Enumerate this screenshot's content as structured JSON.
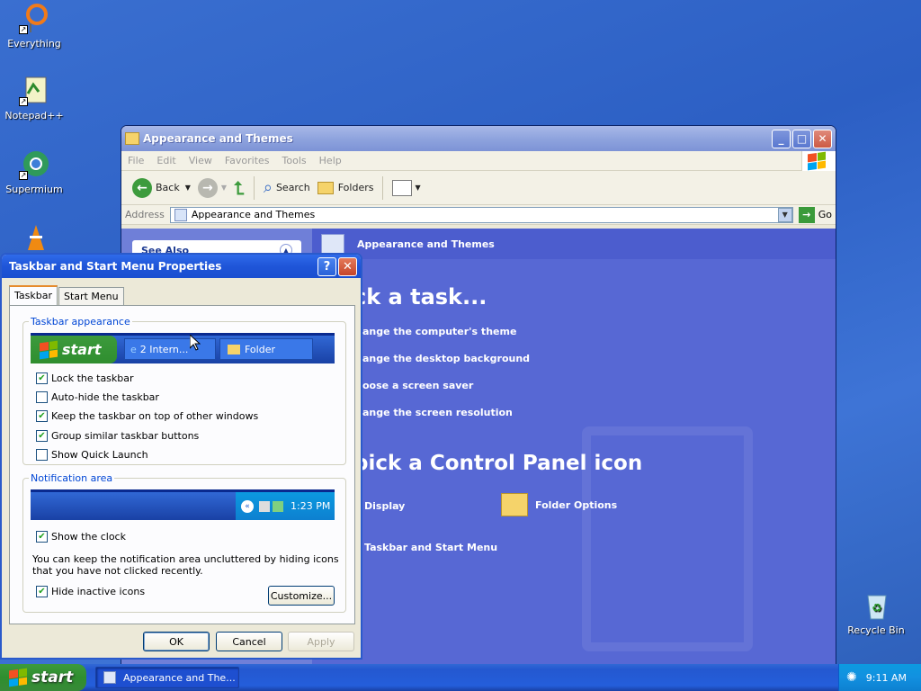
{
  "desktop": {
    "icons": [
      {
        "label": "Everything",
        "icon": "everything-icon"
      },
      {
        "label": "Notepad++",
        "icon": "notepadpp-icon"
      },
      {
        "label": "Supermium",
        "icon": "supermium-icon"
      },
      {
        "label": "Recycle Bin",
        "icon": "recycle-bin-icon"
      }
    ]
  },
  "explorer": {
    "title": "Appearance and Themes",
    "menu": [
      "File",
      "Edit",
      "View",
      "Favorites",
      "Tools",
      "Help"
    ],
    "toolbar": {
      "back": "Back",
      "search": "Search",
      "folders": "Folders"
    },
    "address": {
      "label": "Address",
      "value": "Appearance and Themes",
      "go": "Go"
    },
    "left": {
      "see_also": "See Also"
    },
    "main": {
      "header": "Appearance and Themes",
      "pick_task": "ck a task...",
      "tasks": [
        "ange the computer's theme",
        "ange the desktop background",
        "oose a screen saver",
        "ange the screen resolution"
      ],
      "pick_icon": "pick a Control Panel icon",
      "icons": [
        "Display",
        "Folder Options",
        "Taskbar and Start Menu"
      ]
    }
  },
  "dialog": {
    "title": "Taskbar and Start Menu Properties",
    "tabs": [
      "Taskbar",
      "Start Menu"
    ],
    "appearance": {
      "legend": "Taskbar appearance",
      "preview": {
        "start": "start",
        "item1": "2 Intern...",
        "item2": "Folder"
      },
      "options": [
        {
          "label": "Lock the taskbar",
          "checked": true
        },
        {
          "label": "Auto-hide the taskbar",
          "checked": false
        },
        {
          "label": "Keep the taskbar on top of other windows",
          "checked": true
        },
        {
          "label": "Group similar taskbar buttons",
          "checked": true
        },
        {
          "label": "Show Quick Launch",
          "checked": false
        }
      ]
    },
    "notification": {
      "legend": "Notification area",
      "preview_time": "1:23 PM",
      "show_clock": "Show the clock",
      "description": "You can keep the notification area uncluttered by hiding icons that you have not clicked recently.",
      "hide_inactive": "Hide inactive icons",
      "customize": "Customize..."
    },
    "buttons": {
      "ok": "OK",
      "cancel": "Cancel",
      "apply": "Apply"
    }
  },
  "taskbar": {
    "start": "start",
    "item": "Appearance and The...",
    "clock": "9:11 AM"
  }
}
